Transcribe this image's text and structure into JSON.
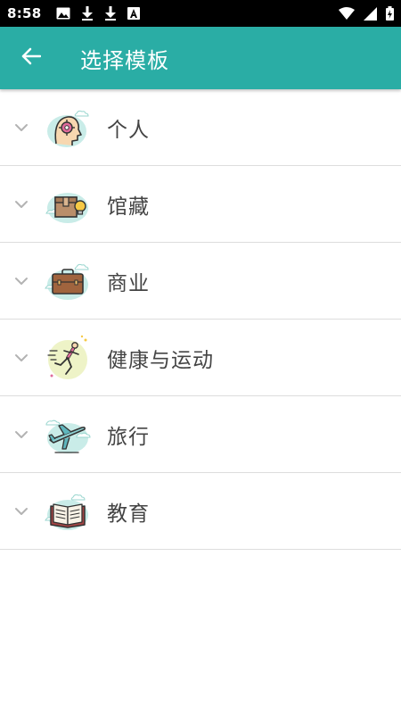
{
  "status_bar": {
    "time": "8:58",
    "left_icons": [
      "image-icon",
      "download-icon",
      "download-icon",
      "a-icon"
    ],
    "right_icons": [
      "wifi-icon",
      "cell-signal-icon",
      "battery-icon"
    ]
  },
  "app_bar": {
    "title": "选择模板",
    "back_icon": "arrow-left-icon",
    "background": "#2aada5"
  },
  "templates": [
    {
      "label": "个人",
      "icon": "head-gear-icon"
    },
    {
      "label": "馆藏",
      "icon": "box-lightbulb-icon"
    },
    {
      "label": "商业",
      "icon": "briefcase-icon"
    },
    {
      "label": "健康与运动",
      "icon": "runner-icon"
    },
    {
      "label": "旅行",
      "icon": "airplane-icon"
    },
    {
      "label": "教育",
      "icon": "book-icon"
    }
  ]
}
